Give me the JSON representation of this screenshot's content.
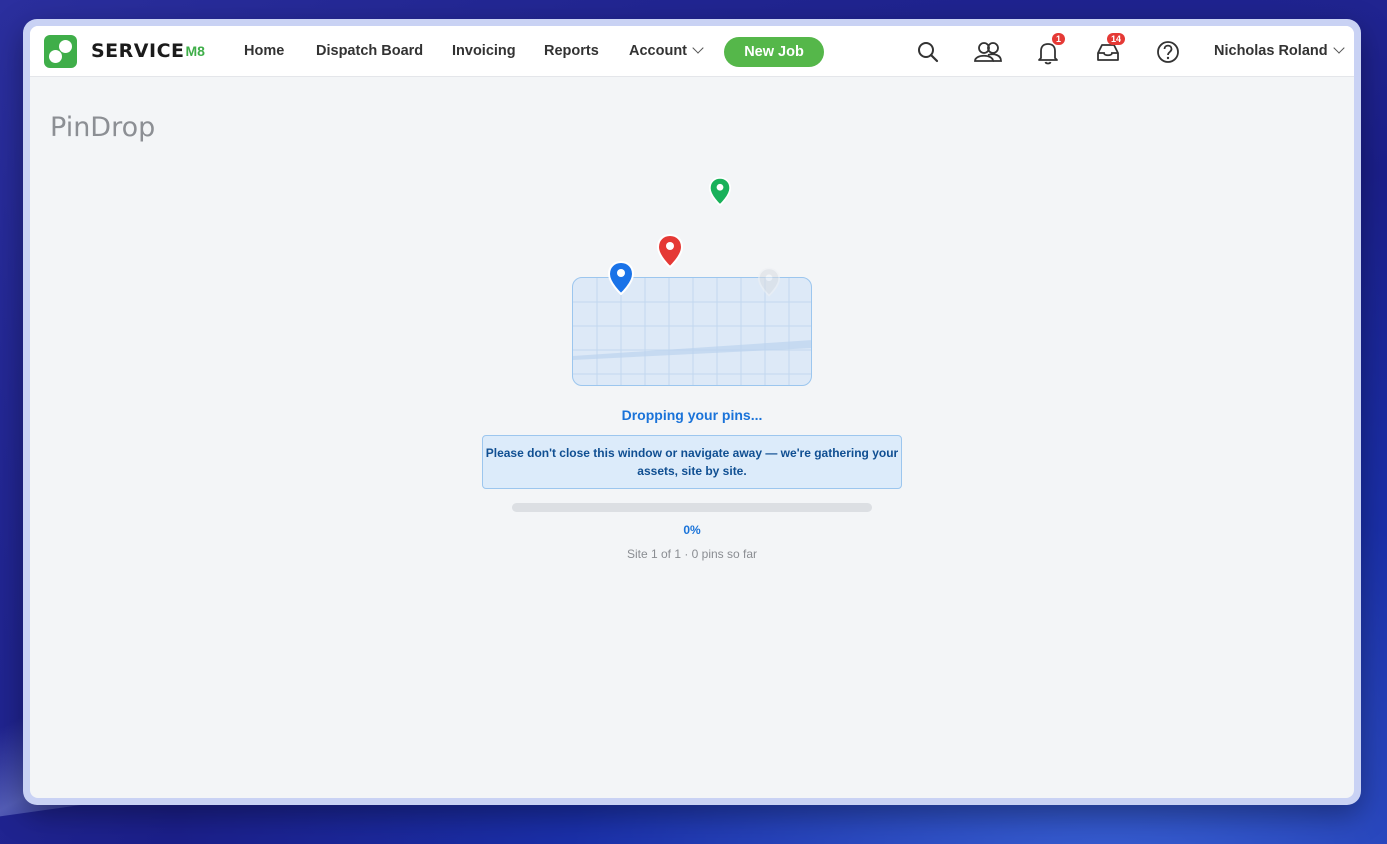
{
  "brand": {
    "name": "SERVICE",
    "suffix": "M8",
    "accent_color": "#3fae49"
  },
  "nav": {
    "home": "Home",
    "dispatch_board": "Dispatch Board",
    "invoicing": "Invoicing",
    "reports": "Reports",
    "account": "Account",
    "new_job": "New Job"
  },
  "header_icons": {
    "search": "search-icon",
    "contacts": "people-icon",
    "notifications": {
      "icon": "bell-icon",
      "badge": "1"
    },
    "inbox": {
      "icon": "inbox-icon",
      "badge": "14"
    },
    "help": "help-icon"
  },
  "user": {
    "name": "Nicholas Roland"
  },
  "page": {
    "title": "PinDrop"
  },
  "loader": {
    "status": "Dropping your pins...",
    "notice": "Please don't close this window or navigate away — we're gathering your assets, site by site.",
    "progress_percent": 0,
    "progress_label": "0%",
    "site_info": "Site 1 of 1 · 0 pins so far",
    "pin_colors": [
      "#1a73e8",
      "#e53935",
      "#19b15a",
      "#d8dde3"
    ]
  }
}
